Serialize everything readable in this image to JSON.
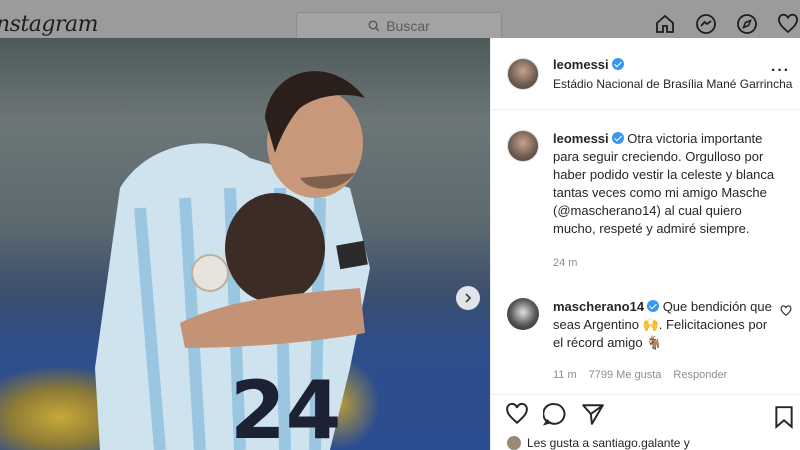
{
  "app": {
    "logo_text": "nstagram"
  },
  "search": {
    "placeholder": "Buscar",
    "icon": "search-icon"
  },
  "nav": {
    "icons": [
      "home-icon",
      "messenger-icon",
      "explore-icon",
      "heart-icon"
    ]
  },
  "post": {
    "username": "leomessi",
    "verified": true,
    "location": "Estádio Nacional de Brasília Mané Garrincha",
    "caption_username": "leomessi",
    "caption_text": "Otra victoria importante para seguir creciendo. Orgulloso por haber podido vestir la celeste y blanca tantas veces como mi amigo Masche (@mascherano14) al cual quiero mucho, respeté y admiré siempre.",
    "caption_time": "24 m"
  },
  "comment": {
    "username": "mascherano14",
    "verified": true,
    "text": "Que bendición que seas Argentino 🙌. Felicitaciones por el récord amigo 🐐",
    "time": "11 m",
    "likes": "7799 Me gusta",
    "reply": "Responder"
  },
  "likes_row": {
    "text": "Les gusta a santiago.galante y"
  },
  "colors": {
    "verified": "#3897f0",
    "text": "#262626",
    "muted": "#8e8e8e"
  }
}
